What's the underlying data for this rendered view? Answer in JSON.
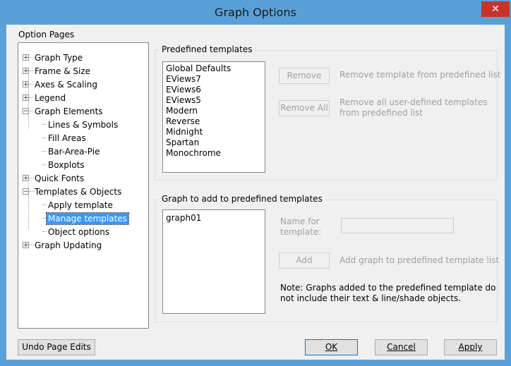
{
  "window": {
    "title": "Graph Options",
    "close_glyph": "✕"
  },
  "option_pages": {
    "label": "Option Pages",
    "tree": [
      {
        "label": "Graph Type"
      },
      {
        "label": "Frame & Size"
      },
      {
        "label": "Axes & Scaling"
      },
      {
        "label": "Legend"
      },
      {
        "label": "Graph Elements"
      },
      {
        "label": "Lines & Symbols"
      },
      {
        "label": "Fill Areas"
      },
      {
        "label": "Bar-Area-Pie"
      },
      {
        "label": "Boxplots"
      },
      {
        "label": "Quick Fonts"
      },
      {
        "label": "Templates & Objects"
      },
      {
        "label": "Apply template"
      },
      {
        "label": "Manage templates"
      },
      {
        "label": "Object options"
      },
      {
        "label": "Graph Updating"
      }
    ],
    "selected": "Manage templates"
  },
  "predefined": {
    "title": "Predefined templates",
    "items": [
      "Global Defaults",
      "EViews7",
      "EViews6",
      "EViews5",
      "Modern",
      "Reverse",
      "Midnight",
      "Spartan",
      "Monochrome"
    ],
    "remove_label": "Remove",
    "remove_hint": "Remove template from predefined list",
    "remove_all_label": "Remove All",
    "remove_all_hint_1": "Remove all user-defined templates",
    "remove_all_hint_2": "from predefined list"
  },
  "add_graph": {
    "title": "Graph to add to predefined templates",
    "items": [
      "graph01"
    ],
    "name_label_1": "Name for",
    "name_label_2": "template:",
    "name_value": "",
    "add_label": "Add",
    "add_hint": "Add graph to predefined template list",
    "note_1": "Note: Graphs added to the predefined template do",
    "note_2": "not include their text & line/shade objects."
  },
  "footer": {
    "undo_label": "Undo Page Edits",
    "ok_label": "OK",
    "cancel_label": "Cancel",
    "apply_label": "Apply"
  }
}
